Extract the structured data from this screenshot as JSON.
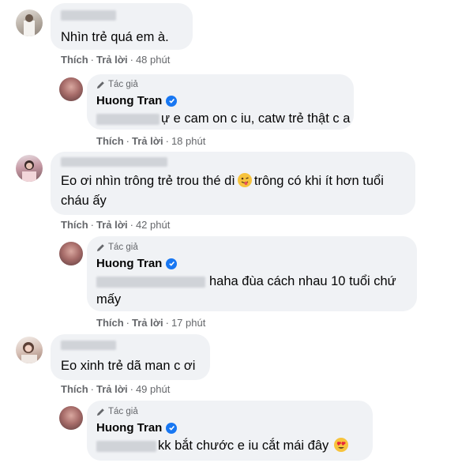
{
  "comments": [
    {
      "text": "Nhìn trẻ quá em à.",
      "like": "Thích",
      "reply": "Trả lời",
      "time": "48 phút"
    },
    {
      "text_line1": "Eo ơi nhìn trông trẻ trou thé dì",
      "text_line1b": "trông có khi ít hơn tuổi",
      "text_line2": "cháu ấy",
      "like": "Thích",
      "reply": "Trả lời",
      "time": "42 phút"
    },
    {
      "text": "Eo xinh trẻ dã man c ơi",
      "like": "Thích",
      "reply": "Trả lời",
      "time": "49 phút"
    }
  ],
  "replies": [
    {
      "tag": "Tác giả",
      "author": "Huong Tran",
      "text": "ự e cam on c iu, catw trẻ thật c a",
      "like": "Thích",
      "reply": "Trả lời",
      "time": "18 phút"
    },
    {
      "tag": "Tác giả",
      "author": "Huong Tran",
      "text_line1": "haha đùa cách nhau 10 tuổi chứ",
      "text_line2": "mấy",
      "like": "Thích",
      "reply": "Trả lời",
      "time": "17 phút"
    },
    {
      "tag": "Tác giả",
      "author": "Huong Tran",
      "text": "kk bắt chước e iu cắt mái đây"
    }
  ],
  "icons": {
    "author_tag": "pencil-icon",
    "verified": "verified-check-icon",
    "emoji_wink": "winking-tongue-emoji-icon",
    "emoji_heart_eyes": "heart-eyes-emoji-icon"
  },
  "colors": {
    "bubble": "#f0f2f5",
    "meta": "#65676b",
    "verified": "#1877f2"
  }
}
